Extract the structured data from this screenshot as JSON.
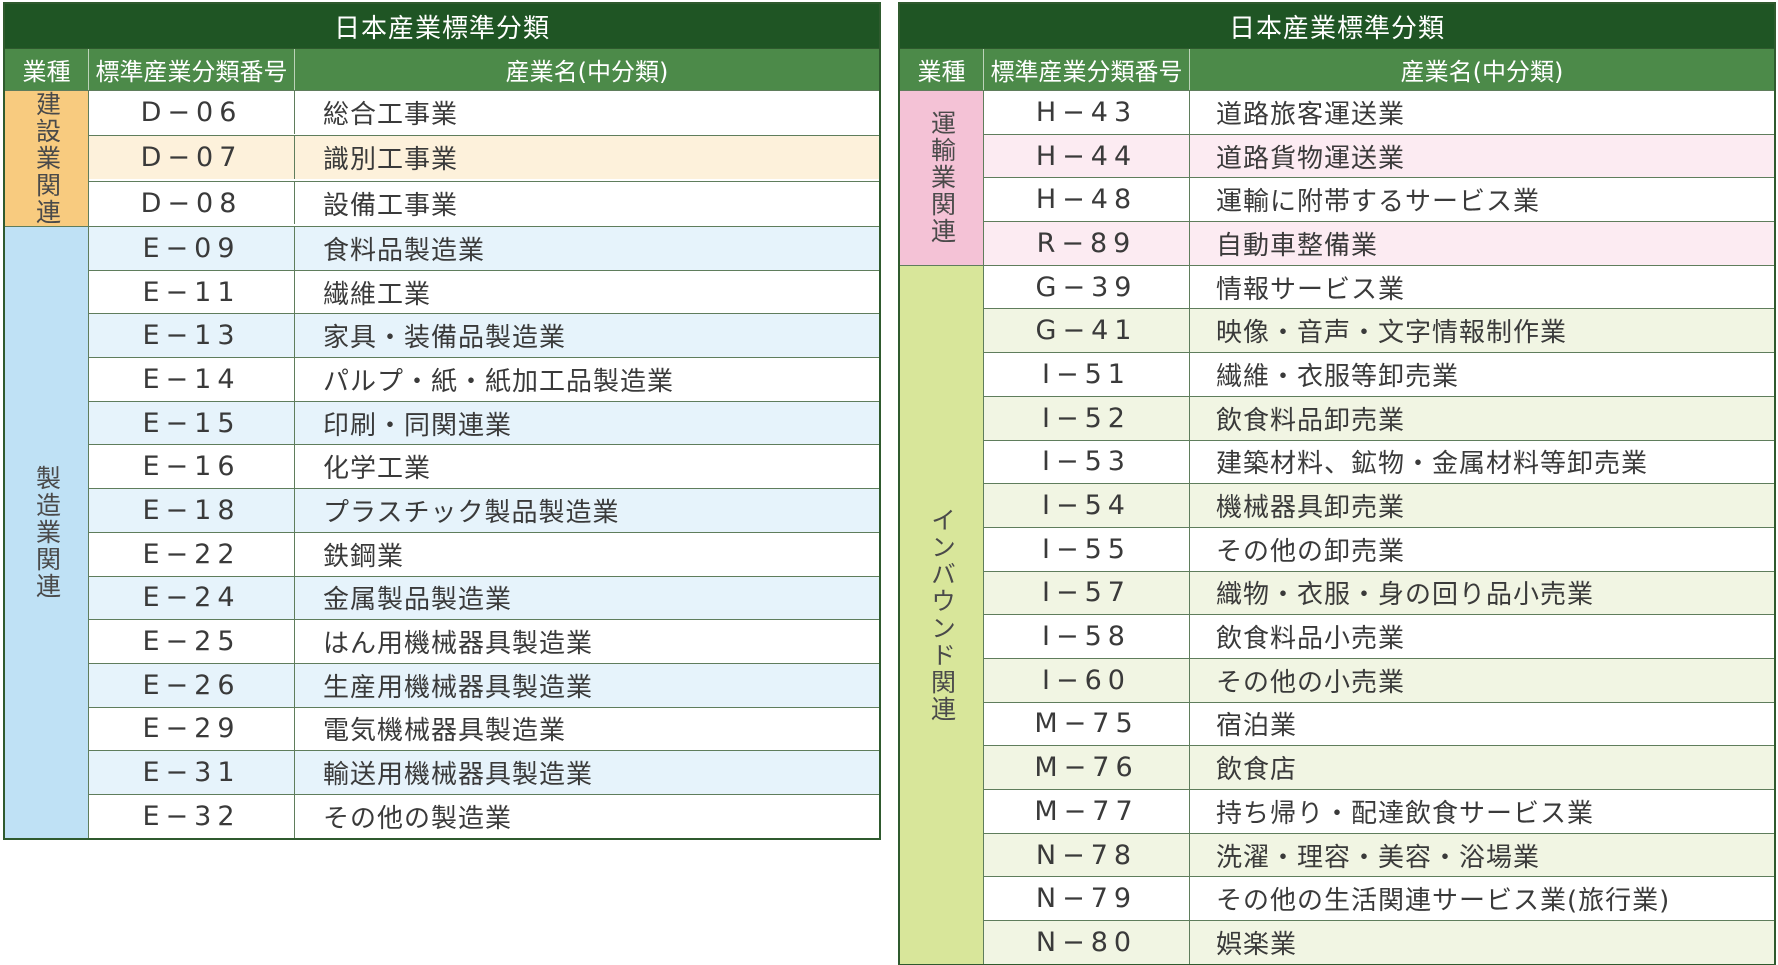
{
  "left": {
    "title": "日本産業標準分類",
    "headers": {
      "industry": "業種",
      "code": "標準産業分類番号",
      "name": "産業名(中分類)"
    },
    "groups": [
      {
        "category": "建設業関連",
        "rows": [
          {
            "code": "D−06",
            "name": "総合工事業"
          },
          {
            "code": "D−07",
            "name": "識別工事業"
          },
          {
            "code": "D−08",
            "name": "設備工事業"
          }
        ]
      },
      {
        "category": "製造業関連",
        "rows": [
          {
            "code": "E−09",
            "name": "食料品製造業"
          },
          {
            "code": "E−11",
            "name": "繊維工業"
          },
          {
            "code": "E−13",
            "name": "家具・装備品製造業"
          },
          {
            "code": "E−14",
            "name": "パルプ・紙・紙加工品製造業"
          },
          {
            "code": "E−15",
            "name": "印刷・同関連業"
          },
          {
            "code": "E−16",
            "name": "化学工業"
          },
          {
            "code": "E−18",
            "name": "プラスチック製品製造業"
          },
          {
            "code": "E−22",
            "name": "鉄鋼業"
          },
          {
            "code": "E−24",
            "name": "金属製品製造業"
          },
          {
            "code": "E−25",
            "name": "はん用機械器具製造業"
          },
          {
            "code": "E−26",
            "name": "生産用機械器具製造業"
          },
          {
            "code": "E−29",
            "name": "電気機械器具製造業"
          },
          {
            "code": "E−31",
            "name": "輸送用機械器具製造業"
          },
          {
            "code": "E−32",
            "name": "その他の製造業"
          }
        ]
      }
    ]
  },
  "right": {
    "title": "日本産業標準分類",
    "headers": {
      "industry": "業種",
      "code": "標準産業分類番号",
      "name": "産業名(中分類)"
    },
    "groups": [
      {
        "category": "運輸業関連",
        "rows": [
          {
            "code": "H−43",
            "name": "道路旅客運送業"
          },
          {
            "code": "H−44",
            "name": "道路貨物運送業"
          },
          {
            "code": "H−48",
            "name": "運輸に附帯するサービス業"
          },
          {
            "code": "R−89",
            "name": "自動車整備業"
          }
        ]
      },
      {
        "category": "インバウンド関連",
        "rows": [
          {
            "code": "G−39",
            "name": "情報サービス業"
          },
          {
            "code": "G−41",
            "name": "映像・音声・文字情報制作業"
          },
          {
            "code": "I−51",
            "name": "繊維・衣服等卸売業"
          },
          {
            "code": "I−52",
            "name": "飲食料品卸売業"
          },
          {
            "code": "I−53",
            "name": "建築材料、鉱物・金属材料等卸売業"
          },
          {
            "code": "I−54",
            "name": "機械器具卸売業"
          },
          {
            "code": "I−55",
            "name": "その他の卸売業"
          },
          {
            "code": "I−57",
            "name": "織物・衣服・身の回り品小売業"
          },
          {
            "code": "I−58",
            "name": "飲食料品小売業"
          },
          {
            "code": "I−60",
            "name": "その他の小売業"
          },
          {
            "code": "M−75",
            "name": "宿泊業"
          },
          {
            "code": "M−76",
            "name": "飲食店"
          },
          {
            "code": "M−77",
            "name": "持ち帰り・配達飲食サービス業"
          },
          {
            "code": "N−78",
            "name": "洗濯・理容・美容・浴場業"
          },
          {
            "code": "N−79",
            "name": "その他の生活関連サービス業(旅行業)"
          },
          {
            "code": "N−80",
            "name": "娯楽業"
          }
        ]
      }
    ]
  },
  "colors": {
    "title_bg": "#1f5524",
    "header_bg": "#4c8a49",
    "construction": "#f8cb7f",
    "manufacturing": "#bfe1f5",
    "transport": "#f4c2d6",
    "inbound": "#d8e69a"
  }
}
